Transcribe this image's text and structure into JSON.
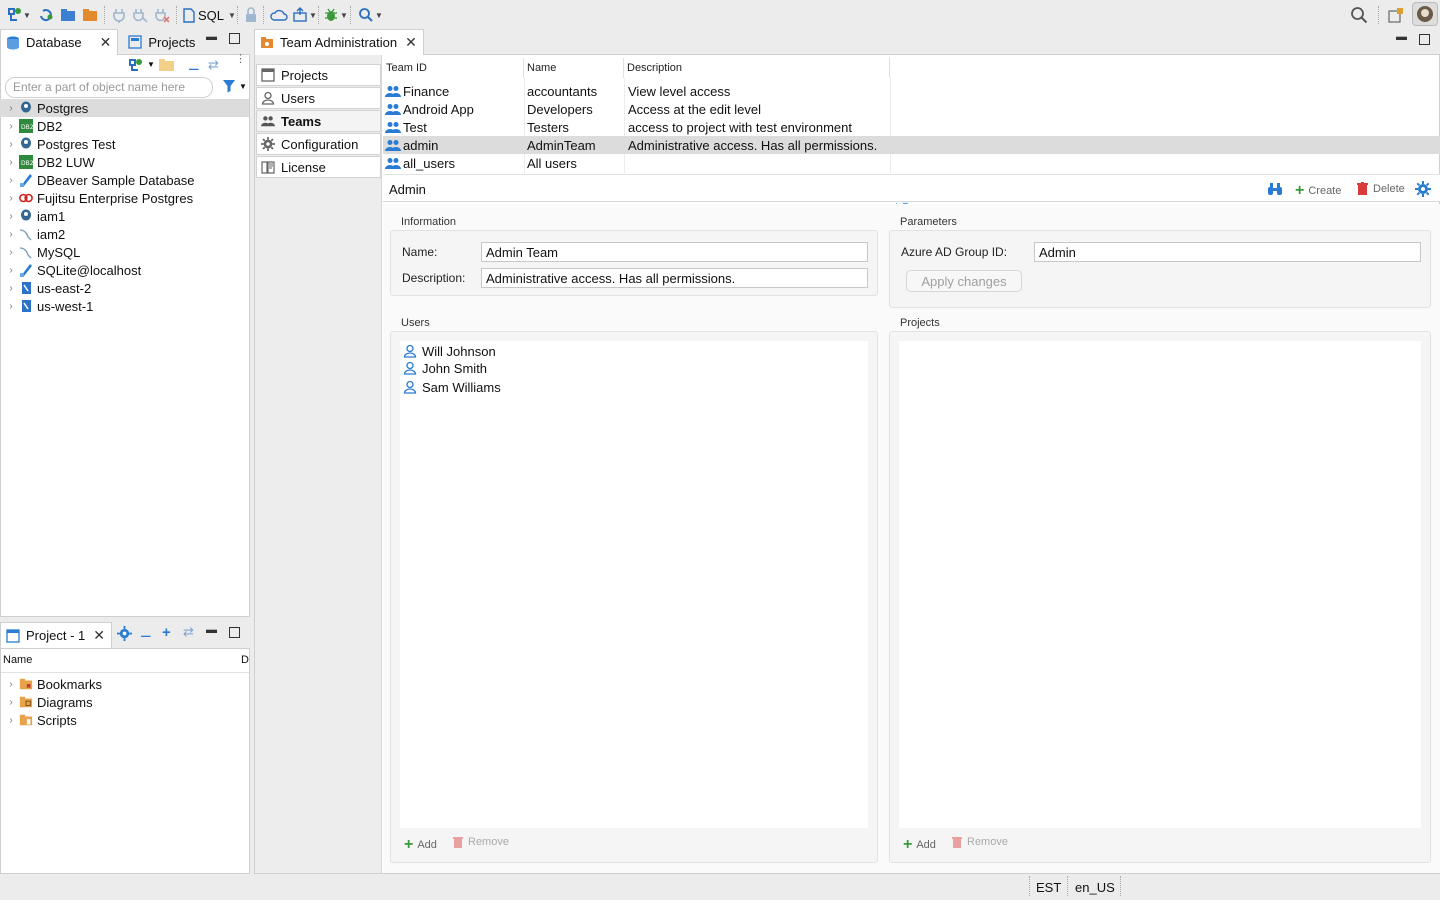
{
  "toolbar": {
    "sql_label": "SQL",
    "icons": [
      "new-connection-icon",
      "refresh-icon",
      "open-folder-icon",
      "open-project-icon",
      "connect-icon",
      "disconnect-icon",
      "disconnect-all-icon",
      "sql-editor-icon",
      "lock-icon",
      "cloud-icon",
      "deploy-icon",
      "debug-icon",
      "search-icon",
      "global-search-icon",
      "open-perspective-icon",
      "avatar"
    ]
  },
  "left_panel": {
    "tabs": [
      {
        "label": "Database"
      },
      {
        "label": "Projects"
      }
    ],
    "filter_placeholder": "Enter a part of object name here",
    "tree": [
      {
        "label": "Postgres",
        "icon": "postgres-icon",
        "selected": true
      },
      {
        "label": "DB2",
        "icon": "db2-icon"
      },
      {
        "label": "Postgres Test",
        "icon": "postgres-icon"
      },
      {
        "label": "DB2 LUW",
        "icon": "db2-icon"
      },
      {
        "label": "DBeaver Sample Database",
        "icon": "sqlite-icon"
      },
      {
        "label": "Fujitsu Enterprise Postgres",
        "icon": "fujitsu-icon"
      },
      {
        "label": "iam1",
        "icon": "postgres-icon"
      },
      {
        "label": "iam2",
        "icon": "mysql-icon"
      },
      {
        "label": "MySQL",
        "icon": "mysql-icon"
      },
      {
        "label": "SQLite@localhost",
        "icon": "sqlite-icon"
      },
      {
        "label": "us-east-2",
        "icon": "aws-icon"
      },
      {
        "label": "us-west-1",
        "icon": "aws-icon"
      }
    ]
  },
  "project_panel": {
    "title": "Project - 1",
    "col_name": "Name",
    "col_d": "D",
    "items": [
      {
        "label": "Bookmarks"
      },
      {
        "label": "Diagrams"
      },
      {
        "label": "Scripts"
      }
    ]
  },
  "editor": {
    "tab_label": "Team Administration",
    "nav": [
      {
        "label": "Projects",
        "icon": "projects-icon"
      },
      {
        "label": "Users",
        "icon": "user-icon"
      },
      {
        "label": "Teams",
        "icon": "team-icon",
        "active": true
      },
      {
        "label": "Configuration",
        "icon": "gear-icon"
      },
      {
        "label": "License",
        "icon": "license-icon"
      }
    ],
    "table": {
      "headers": [
        "Team ID",
        "Name",
        "Description"
      ],
      "rows": [
        {
          "id": "Finance",
          "name": "accountants",
          "desc": "View level access"
        },
        {
          "id": "Android App",
          "name": "Developers",
          "desc": "Access at the edit level"
        },
        {
          "id": "Test",
          "name": "Testers",
          "desc": "access to project with test environment"
        },
        {
          "id": "admin",
          "name": "AdminTeam",
          "desc": "Administrative access. Has all permissions.",
          "selected": true
        },
        {
          "id": "all_users",
          "name": "All users",
          "desc": ""
        }
      ]
    },
    "detail": {
      "title": "Admin",
      "create_label": "Create",
      "delete_label": "Delete",
      "information_label": "Information",
      "name_label": "Name:",
      "name_value": "Admin Team",
      "description_label": "Description:",
      "description_value": "Administrative access. Has all permissions.",
      "parameters_label": "Parameters",
      "azure_label": "Azure AD Group ID:",
      "azure_value": "Admin",
      "apply_label": "Apply changes",
      "users_label": "Users",
      "users": [
        "Will Johnson",
        "John Smith",
        "Sam Williams"
      ],
      "projects_label": "Projects",
      "add_label": "Add",
      "remove_label": "Remove"
    }
  },
  "status": {
    "tz": "EST",
    "locale": "en_US"
  },
  "colors": {
    "accent_blue": "#2a7bd3",
    "create_green": "#3a9a3a",
    "delete_red": "#d93a3a",
    "selection": "#dcdcdc"
  }
}
